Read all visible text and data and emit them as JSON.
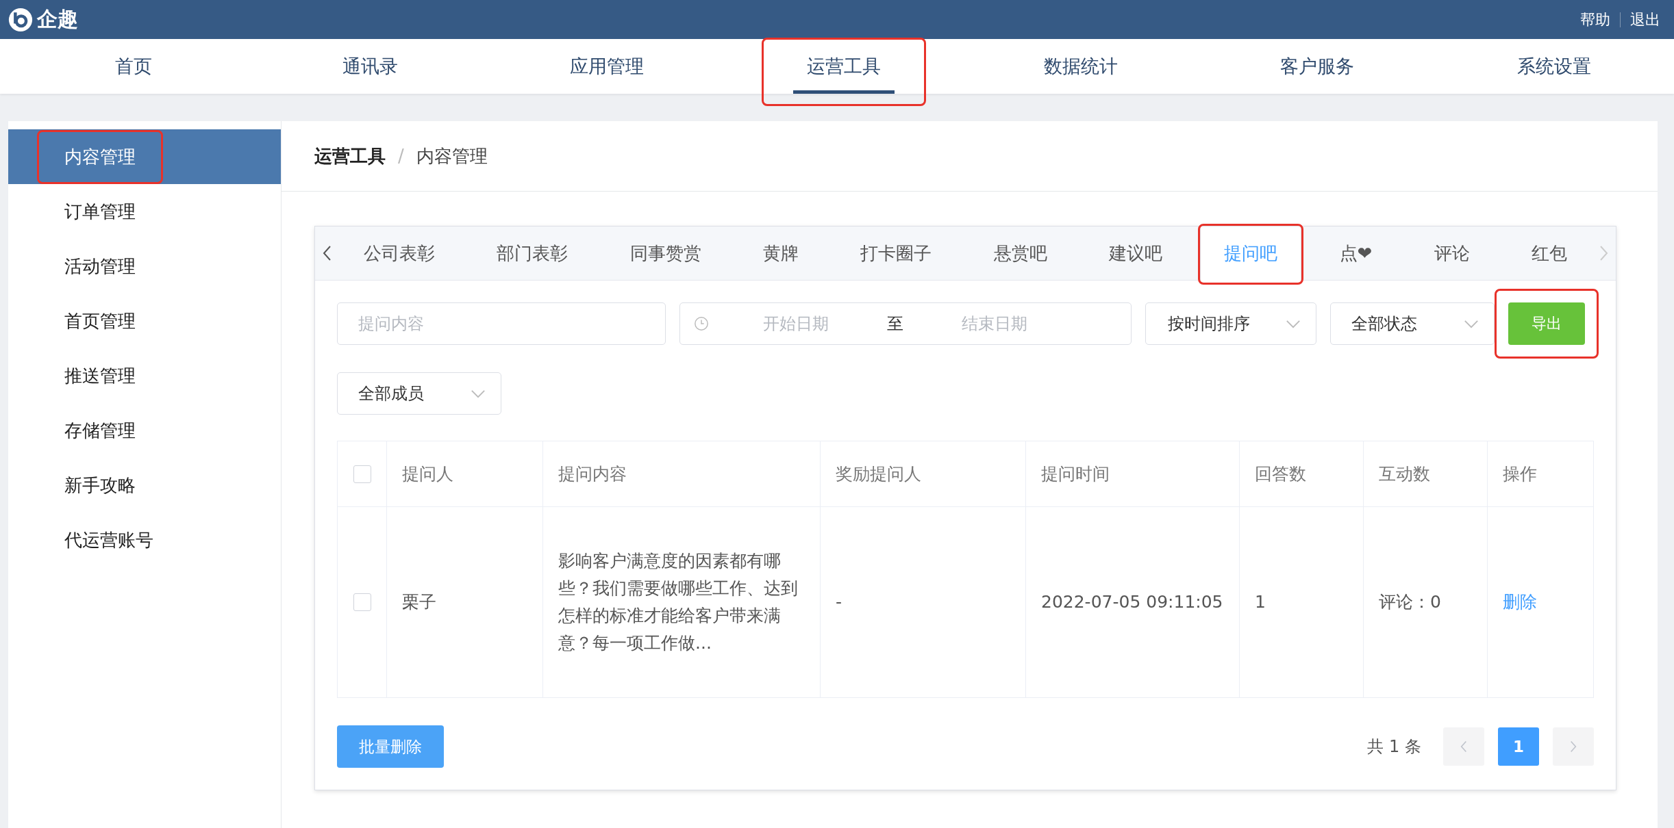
{
  "brand": {
    "name": "企趣"
  },
  "top_links": [
    "帮助",
    "退出"
  ],
  "nav": [
    {
      "label": "首页",
      "selected": false,
      "annotated": false
    },
    {
      "label": "通讯录",
      "selected": false,
      "annotated": false
    },
    {
      "label": "应用管理",
      "selected": false,
      "annotated": false
    },
    {
      "label": "运营工具",
      "selected": true,
      "annotated": true
    },
    {
      "label": "数据统计",
      "selected": false,
      "annotated": false
    },
    {
      "label": "客户服务",
      "selected": false,
      "annotated": false
    },
    {
      "label": "系统设置",
      "selected": false,
      "annotated": false
    }
  ],
  "sidebar": {
    "items": [
      {
        "label": "内容管理",
        "selected": true,
        "annotated": true
      },
      {
        "label": "订单管理",
        "selected": false,
        "annotated": false
      },
      {
        "label": "活动管理",
        "selected": false,
        "annotated": false
      },
      {
        "label": "首页管理",
        "selected": false,
        "annotated": false
      },
      {
        "label": "推送管理",
        "selected": false,
        "annotated": false
      },
      {
        "label": "存储管理",
        "selected": false,
        "annotated": false
      },
      {
        "label": "新手攻略",
        "selected": false,
        "annotated": false
      },
      {
        "label": "代运营账号",
        "selected": false,
        "annotated": false
      }
    ]
  },
  "breadcrumb": {
    "separator": "/",
    "items": [
      "运营工具",
      "内容管理"
    ]
  },
  "tabs": [
    {
      "label": "公司表彰",
      "selected": false,
      "annotated": false
    },
    {
      "label": "部门表彰",
      "selected": false,
      "annotated": false
    },
    {
      "label": "同事赞赏",
      "selected": false,
      "annotated": false
    },
    {
      "label": "黄牌",
      "selected": false,
      "annotated": false
    },
    {
      "label": "打卡圈子",
      "selected": false,
      "annotated": false
    },
    {
      "label": "悬赏吧",
      "selected": false,
      "annotated": false
    },
    {
      "label": "建议吧",
      "selected": false,
      "annotated": false
    },
    {
      "label": "提问吧",
      "selected": true,
      "annotated": true
    },
    {
      "label": "点❤",
      "selected": false,
      "annotated": false
    },
    {
      "label": "评论",
      "selected": false,
      "annotated": false
    },
    {
      "label": "红包",
      "selected": false,
      "annotated": false
    }
  ],
  "filters": [
    {
      "kind": "search",
      "placeholder": "提问内容"
    },
    {
      "kind": "date_range",
      "start_placeholder": "开始日期",
      "separator": "至",
      "end_placeholder": "结束日期"
    },
    {
      "kind": "select",
      "value": "按时间排序"
    },
    {
      "kind": "select",
      "value": "全部状态"
    },
    {
      "kind": "button",
      "label": "导出",
      "annotated": true
    },
    {
      "kind": "select",
      "value": "全部成员"
    }
  ],
  "table": {
    "header_checked": false,
    "columns": [
      "提问人",
      "提问内容",
      "奖励提问人",
      "提问时间",
      "回答数",
      "互动数",
      "操作"
    ],
    "rows": [
      {
        "checked": false,
        "cells": [
          "栗子",
          "影响客户满意度的因素都有哪些？我们需要做哪些工作、达到怎样的标准才能给客户带来满意？每一项工作做...",
          "-",
          "2022-07-05 09:11:05",
          "1",
          "评论：0"
        ],
        "action": "删除"
      }
    ]
  },
  "bulk_delete": "批量删除",
  "pagination": {
    "total": "共 1 条",
    "prev_disabled": true,
    "next_disabled": true,
    "pages": [
      {
        "label": "1",
        "selected": true
      }
    ]
  }
}
